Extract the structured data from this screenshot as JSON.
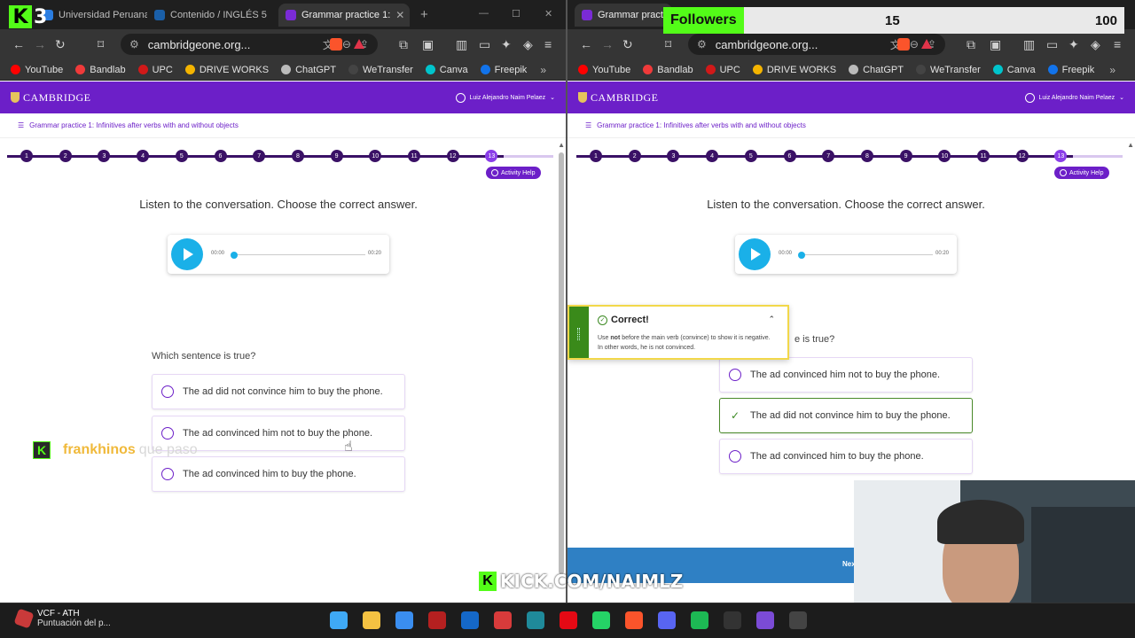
{
  "left": {
    "tabs": [
      {
        "label": "Universidad Peruana de C",
        "color": "#2a7de1"
      },
      {
        "label": "Contenido / INGLÉS 5",
        "color": "#1a5fa8"
      },
      {
        "label": "Grammar practice 1:",
        "color": "#7a2bd6"
      }
    ],
    "url": "cambridgeone.org...",
    "bookmarks": [
      {
        "label": "YouTube",
        "color": "#ff0000"
      },
      {
        "label": "Bandlab",
        "color": "#f03a3a"
      },
      {
        "label": "UPC",
        "color": "#d11919"
      },
      {
        "label": "DRIVE WORKS",
        "color": "#f4b400"
      },
      {
        "label": "ChatGPT",
        "color": "#bbbbbb"
      },
      {
        "label": "WeTransfer",
        "color": "#444444"
      },
      {
        "label": "Canva",
        "color": "#00c4cc"
      },
      {
        "label": "Freepik",
        "color": "#1273eb"
      }
    ],
    "bookmarks_more": "»",
    "logo": "CAMBRIDGE",
    "user": "Luiz Alejandro Naim Pelaez",
    "breadcrumb": "Grammar practice 1: Infinitives after verbs with and without objects",
    "steps": [
      "1",
      "2",
      "3",
      "4",
      "5",
      "6",
      "7",
      "8",
      "9",
      "10",
      "11",
      "12",
      "13"
    ],
    "current_step": "13",
    "activity_help": "Activity Help",
    "instruction": "Listen to the conversation. Choose the correct answer.",
    "audio": {
      "current": "00:00",
      "duration": "00:20"
    },
    "question": "Which sentence is true?",
    "options": [
      "The ad did not convince him to buy the phone.",
      "The ad convinced him not to buy the phone.",
      "The ad convinced him to buy the phone."
    ]
  },
  "right": {
    "tab": {
      "label": "Grammar practic",
      "color": "#7a2bd6"
    },
    "url": "cambridgeone.org...",
    "bookmarks": [
      {
        "label": "YouTube",
        "color": "#ff0000"
      },
      {
        "label": "Bandlab",
        "color": "#f03a3a"
      },
      {
        "label": "UPC",
        "color": "#d11919"
      },
      {
        "label": "DRIVE WORKS",
        "color": "#f4b400"
      },
      {
        "label": "ChatGPT",
        "color": "#bbbbbb"
      },
      {
        "label": "WeTransfer",
        "color": "#444444"
      },
      {
        "label": "Canva",
        "color": "#00c4cc"
      },
      {
        "label": "Freepik",
        "color": "#1273eb"
      }
    ],
    "bookmarks_more": "»",
    "logo": "CAMBRIDGE",
    "user": "Luiz Alejandro Naim Pelaez",
    "breadcrumb": "Grammar practice 1: Infinitives after verbs with and without objects",
    "activity_help": "Activity Help",
    "instruction": "Listen to the conversation. Choose the correct answer.",
    "audio": {
      "current": "00:00",
      "duration": "00:20"
    },
    "question_partial": "e is true?",
    "options": [
      {
        "text": "The ad convinced him not to buy the phone.",
        "state": "radio"
      },
      {
        "text": "The ad did not convince him to buy the phone.",
        "state": "correct"
      },
      {
        "text": "The ad convinced him to buy the phone.",
        "state": "radio"
      }
    ],
    "feedback": {
      "title": "Correct!",
      "body_pre": "Use ",
      "body_bold": "not",
      "body_post": " before the main verb (convince) to show it is negative. In other words, he is not convinced."
    },
    "next_label": "Nex"
  },
  "overlay": {
    "k3_letter": "K",
    "k3_number": "3",
    "followers_label": "Followers",
    "followers_current": "15",
    "followers_goal": "100",
    "chat_badge": "K",
    "chat_user": "frankhinos",
    "chat_message": "que paso",
    "kick_badge": "K",
    "kick_url": "KICK.COM/NAIMLZ"
  },
  "taskbar": {
    "weather_title": "VCF - ATH",
    "weather_sub": "Puntuación del p...",
    "apps": [
      {
        "name": "windows-start",
        "color": "#3fa9f5"
      },
      {
        "name": "file-explorer",
        "color": "#f5c242"
      },
      {
        "name": "store",
        "color": "#3a8ef0"
      },
      {
        "name": "app-red",
        "color": "#b52020"
      },
      {
        "name": "outlook",
        "color": "#1568c8"
      },
      {
        "name": "app-grid",
        "color": "#d83b3b"
      },
      {
        "name": "app-teal",
        "color": "#1f8a9a"
      },
      {
        "name": "netflix",
        "color": "#e50914"
      },
      {
        "name": "whatsapp",
        "color": "#25d366"
      },
      {
        "name": "brave",
        "color": "#fb542b"
      },
      {
        "name": "discord",
        "color": "#5865f2"
      },
      {
        "name": "spotify",
        "color": "#1db954"
      },
      {
        "name": "audio-app",
        "color": "#333333"
      },
      {
        "name": "app-purple",
        "color": "#7b4bd6"
      },
      {
        "name": "app-record",
        "color": "#444444"
      }
    ]
  }
}
